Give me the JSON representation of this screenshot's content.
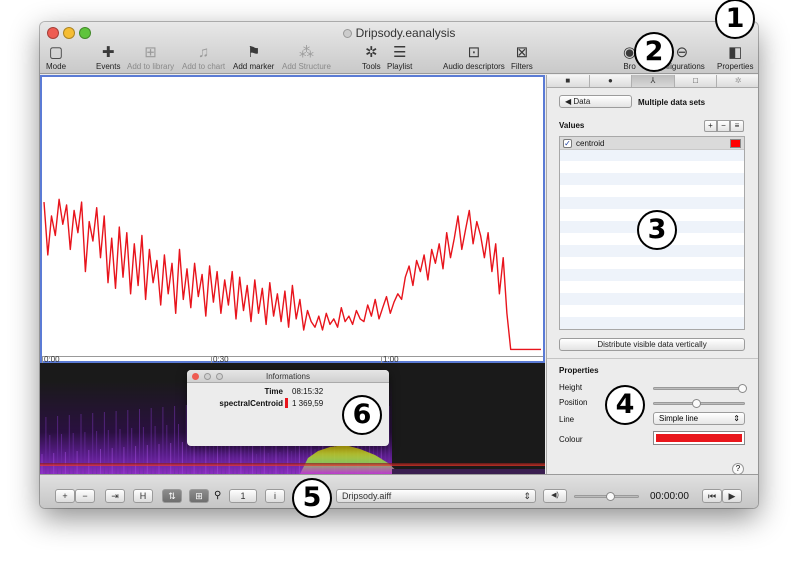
{
  "window": {
    "title": "Dripsody.eanalysis"
  },
  "toolbar": {
    "mode": "Mode",
    "events": "Events",
    "add_to_library": "Add to library",
    "add_to_chart": "Add to chart",
    "add_marker": "Add marker",
    "add_structure": "Add Structure",
    "tools": "Tools",
    "playlist": "Playlist",
    "audio_descriptors": "Audio descriptors",
    "filters": "Filters",
    "browser": "Bro",
    "configurations": "onfigurations",
    "properties": "Properties"
  },
  "timeline": {
    "ticks": [
      "0:00",
      "0:30",
      "1:00"
    ]
  },
  "waveform": {
    "color": "#e8141c",
    "samples": [
      0.55,
      0.36,
      0.5,
      0.43,
      0.56,
      0.47,
      0.54,
      0.38,
      0.52,
      0.44,
      0.55,
      0.3,
      0.48,
      0.41,
      0.53,
      0.35,
      0.5,
      0.26,
      0.42,
      0.24,
      0.46,
      0.28,
      0.44,
      0.22,
      0.4,
      0.25,
      0.43,
      0.2,
      0.38,
      0.26,
      0.34,
      0.18,
      0.36,
      0.22,
      0.33,
      0.15,
      0.38,
      0.2,
      0.31,
      0.17,
      0.33,
      0.21,
      0.29,
      0.14,
      0.32,
      0.19,
      0.3,
      0.15,
      0.27,
      0.18,
      0.3,
      0.13,
      0.28,
      0.16,
      0.25,
      0.12,
      0.27,
      0.15,
      0.24,
      0.11,
      0.26,
      0.14,
      0.22,
      0.12,
      0.23,
      0.1,
      0.25,
      0.13,
      0.2,
      0.09,
      0.16,
      0.12,
      0.1,
      0.14,
      0.09,
      0.15,
      0.11,
      0.13,
      0.1,
      0.17,
      0.12,
      0.14,
      0.11,
      0.16,
      0.13,
      0.12,
      0.18,
      0.14,
      0.2,
      0.13,
      0.17,
      0.21,
      0.15,
      0.19,
      0.22,
      0.2,
      0.28,
      0.32,
      0.25,
      0.34,
      0.3,
      0.36,
      0.27,
      0.38,
      0.33,
      0.4,
      0.31,
      0.44,
      0.35,
      0.42,
      0.5,
      0.38,
      0.45,
      0.52,
      0.4,
      0.48,
      0.43,
      0.35,
      0.44,
      0.3,
      0.4,
      0.22,
      0.35,
      0.15,
      0.02,
      0.02,
      0.02,
      0.02
    ]
  },
  "info_window": {
    "title": "Informations",
    "time_label": "Time",
    "time_value": "08:15:32",
    "descriptor_label": "spectralCentroid",
    "descriptor_value": "1 369,59"
  },
  "sidebar": {
    "tabs": [
      "■",
      "●",
      "⅄",
      "□",
      "✲"
    ],
    "data_button": "◀ Data",
    "header": "Multiple data sets",
    "values_label": "Values",
    "list_add": "+",
    "list_remove": "−",
    "list_menu": "≡",
    "items": [
      {
        "label": "centroid",
        "checked": "✓",
        "color": "#ff0000"
      }
    ],
    "distribute_button": "Distribute visible data vertically",
    "properties_label": "Properties",
    "height_label": "Height",
    "position_label": "Position",
    "line_label": "Line",
    "line_value": "Simple line",
    "colour_label": "Colour",
    "colour_value": "#e9171c",
    "height_level": 0.97,
    "position_level": 0.47,
    "help": "?"
  },
  "bottombar": {
    "add": "+",
    "remove": "−",
    "snap": "⇥",
    "h": "H",
    "b1": "⇅",
    "b2": "⊞",
    "zoom_icon": "⚲",
    "page": "1",
    "info": "i",
    "file": "Dripsody.aiff",
    "volume_icon": "◀)",
    "time": "00:00:00",
    "rewind": "⏮",
    "play": "▶",
    "volume_level": 0.55
  },
  "callouts": [
    "1",
    "2",
    "3",
    "4",
    "5",
    "6"
  ]
}
